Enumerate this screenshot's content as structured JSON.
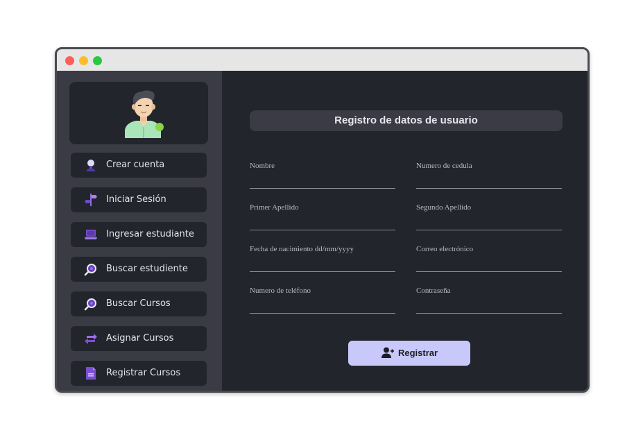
{
  "sidebar": {
    "items": [
      {
        "label": "Crear cuenta",
        "icon": "user-pin-icon"
      },
      {
        "label": "Iniciar Sesión",
        "icon": "signpost-icon"
      },
      {
        "label": "Ingresar estudiante",
        "icon": "laptop-icon"
      },
      {
        "label": "Buscar estudiente",
        "icon": "search-icon"
      },
      {
        "label": "Buscar Cursos",
        "icon": "search-icon"
      },
      {
        "label": "Asignar Cursos",
        "icon": "swap-arrows-icon"
      },
      {
        "label": "Registrar Cursos",
        "icon": "document-icon"
      }
    ]
  },
  "form": {
    "title": "Registro de datos de usuario",
    "fields": {
      "nombre": {
        "label": "Nombre",
        "value": ""
      },
      "cedula": {
        "label": "Numero de cedula",
        "value": ""
      },
      "primer_apellido": {
        "label": "Primer Apellido",
        "value": ""
      },
      "segundo_apellido": {
        "label": "Segundo Apellido",
        "value": ""
      },
      "fecha": {
        "label": "Fecha de nacimiento dd/mm/yyyy",
        "value": ""
      },
      "correo": {
        "label": "Correo electrónico",
        "value": ""
      },
      "telefono": {
        "label": "Numero de teléfono",
        "value": ""
      },
      "contrasena": {
        "label": "Contraseña",
        "value": ""
      }
    },
    "submit_label": "Registrar"
  },
  "colors": {
    "accent": "#c9c8fb",
    "sidebar_bg": "#3a3b45",
    "panel_bg": "#23252c",
    "icon_purple": "#7b4fd1",
    "status_online": "#8bd34a"
  }
}
